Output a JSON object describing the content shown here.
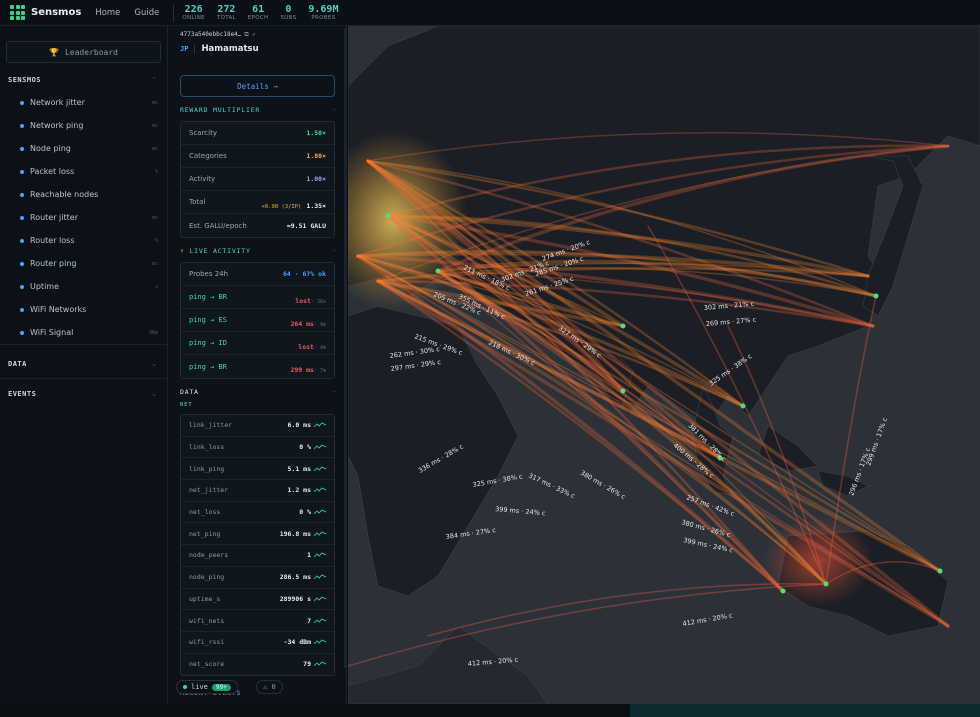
{
  "app": {
    "name": "Sensmos",
    "nav": [
      "Home",
      "Guide"
    ]
  },
  "stats": [
    {
      "value": "226",
      "label": "ONLINE"
    },
    {
      "value": "272",
      "label": "TOTAL"
    },
    {
      "value": "61",
      "label": "EPOCH"
    },
    {
      "value": "0",
      "label": "SUBS"
    },
    {
      "value": "9.69M",
      "label": "PROBES"
    }
  ],
  "sidebar": {
    "leaderboard_label": "Leaderboard",
    "sections": {
      "sensmos": "SENSMOS",
      "data": "DATA",
      "events": "EVENTS"
    },
    "metrics": [
      {
        "label": "Network jitter",
        "unit": "ms"
      },
      {
        "label": "Network ping",
        "unit": "ms"
      },
      {
        "label": "Node ping",
        "unit": "ms"
      },
      {
        "label": "Packet loss",
        "unit": "%"
      },
      {
        "label": "Reachable nodes",
        "unit": ""
      },
      {
        "label": "Router jitter",
        "unit": "ms"
      },
      {
        "label": "Router loss",
        "unit": "%"
      },
      {
        "label": "Router ping",
        "unit": "ms"
      },
      {
        "label": "Uptime",
        "unit": "s"
      },
      {
        "label": "WiFi Networks",
        "unit": ""
      },
      {
        "label": "WiFi Signal",
        "unit": "dBm"
      }
    ]
  },
  "node": {
    "id": "4773a540ebbc18e4…",
    "country": "JP",
    "city": "Hamamatsu",
    "details_label": "Details →"
  },
  "reward": {
    "heading": "REWARD MULTIPLIER",
    "rows": [
      {
        "key": "Scarcity",
        "value": "1.50×",
        "color": "grn"
      },
      {
        "key": "Categories",
        "value": "1.80×",
        "color": "yel"
      },
      {
        "key": "Activity",
        "value": "1.00×",
        "color": "pur"
      }
    ],
    "total_key": "Total",
    "total_note": "×0.90 (3/IP)",
    "total_value": "1.35×",
    "est_key": "Est. GALU/epoch",
    "est_value": "≈9.51 GALU"
  },
  "activity": {
    "heading": "LIVE ACTIVITY",
    "probes_key": "Probes 24h",
    "probes_value": "64 · 67% ok",
    "pings": [
      {
        "target": "ping → BR",
        "value": "lost",
        "age": "· 36s"
      },
      {
        "target": "ping → ES",
        "value": "264 ms",
        "age": "· 4m"
      },
      {
        "target": "ping → ID",
        "value": "lost",
        "age": "· 4m"
      },
      {
        "target": "ping → BR",
        "value": "299 ms",
        "age": "· 7m"
      }
    ]
  },
  "data": {
    "heading": "DATA",
    "subheading": "NET",
    "rows": [
      {
        "key": "link_jitter",
        "value": "6.0 ms"
      },
      {
        "key": "link_loss",
        "value": "0 %"
      },
      {
        "key": "link_ping",
        "value": "5.1 ms"
      },
      {
        "key": "net_jitter",
        "value": "1.2 ms"
      },
      {
        "key": "net_loss",
        "value": "0 %"
      },
      {
        "key": "net_ping",
        "value": "196.8 ms"
      },
      {
        "key": "node_peers",
        "value": "1"
      },
      {
        "key": "node_ping",
        "value": "286.5 ms"
      },
      {
        "key": "uptime_s",
        "value": "289906 s"
      },
      {
        "key": "wifi_nets",
        "value": "7"
      },
      {
        "key": "wifi_rssi",
        "value": "-34 dBm"
      },
      {
        "key": "net_score",
        "value": "79"
      }
    ],
    "next_section": "RECENT EVENTS"
  },
  "footer": {
    "live_label": "live",
    "live_count": "99+",
    "warn_count": "0"
  },
  "map": {
    "arc_labels": [
      "274 ms · 20% c",
      "285 ms · 20% c",
      "302 ms · 21% c",
      "261 ms · 25% c",
      "211 ms · 18% c",
      "355 ms · 11% c",
      "205 ms · 22% c",
      "327 ms · 29% c",
      "218 ms · 30% c",
      "215 ms · 29% c",
      "262 ms · 30% c",
      "297 ms · 29% c",
      "302 ms · 21% c",
      "269 ms · 27% c",
      "325 ms · 38% c",
      "336 ms · 28% c",
      "325 ms · 38% c",
      "317 ms · 33% c",
      "399 ms · 24% c",
      "384 ms · 27% c",
      "380 ms · 26% c",
      "257 ms · 42% c",
      "380 ms · 26% c",
      "399 ms · 24% c",
      "296 ms · 17% c",
      "299 ms · 17% c",
      "412 ms · 20% c",
      "412 ms · 20% c",
      "400 ms · 28% c",
      "381 ms · 28% c"
    ]
  }
}
